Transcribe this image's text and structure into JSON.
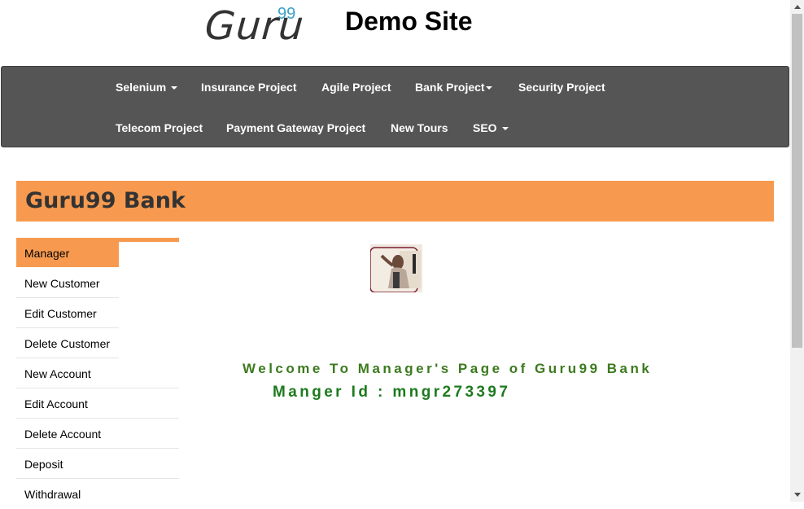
{
  "header": {
    "logo_word": "Guru",
    "logo_sup": "99",
    "site_title": "Demo Site"
  },
  "nav": {
    "row1": [
      {
        "label": "Selenium",
        "dropdown": true
      },
      {
        "label": "Insurance Project",
        "dropdown": false
      },
      {
        "label": "Agile Project",
        "dropdown": false
      },
      {
        "label": "Bank Project",
        "dropdown": true
      },
      {
        "label": "Security Project",
        "dropdown": false
      }
    ],
    "row2": [
      {
        "label": "Telecom Project",
        "dropdown": false
      },
      {
        "label": "Payment Gateway Project",
        "dropdown": false
      },
      {
        "label": "New Tours",
        "dropdown": false
      },
      {
        "label": "SEO",
        "dropdown": true
      }
    ]
  },
  "bank": {
    "title": "Guru99 Bank"
  },
  "sidebar": {
    "items": [
      {
        "label": "Manager",
        "active": true
      },
      {
        "label": "New Customer"
      },
      {
        "label": "Edit Customer"
      },
      {
        "label": "Delete Customer"
      },
      {
        "label": "New Account"
      },
      {
        "label": "Edit Account"
      },
      {
        "label": "Delete Account"
      },
      {
        "label": "Deposit"
      },
      {
        "label": "Withdrawal"
      }
    ]
  },
  "main": {
    "welcome": "Welcome To Manager's Page of Guru99 Bank",
    "manager_id": "Manger Id : mngr273397"
  },
  "colors": {
    "accent": "#f79a4f",
    "navbar": "#555555",
    "welcome_text": "#3c7a1e",
    "logo_sup": "#3aa0c8"
  }
}
